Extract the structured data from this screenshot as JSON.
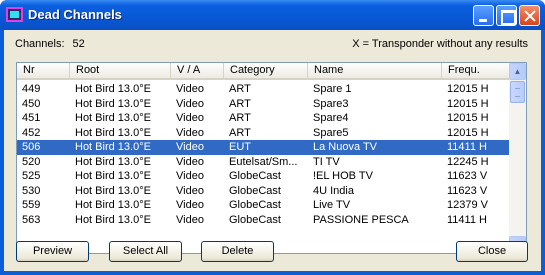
{
  "window": {
    "title": "Dead Channels",
    "icon": "app-icon"
  },
  "info": {
    "channels_label": "Channels:",
    "channels_count": "52",
    "legend": "X = Transponder without any results"
  },
  "table": {
    "columns": [
      "Nr",
      "Root",
      "V / A",
      "Category",
      "Name",
      "Frequ."
    ],
    "rows": [
      [
        "449",
        "Hot Bird 13.0°E",
        "Video",
        "ART",
        "Spare 1",
        "12015 H"
      ],
      [
        "450",
        "Hot Bird 13.0°E",
        "Video",
        "ART",
        "Spare3",
        "12015 H"
      ],
      [
        "451",
        "Hot Bird 13.0°E",
        "Video",
        "ART",
        "Spare4",
        "12015 H"
      ],
      [
        "452",
        "Hot Bird 13.0°E",
        "Video",
        "ART",
        "Spare5",
        "12015 H"
      ],
      [
        "506",
        "Hot Bird 13.0°E",
        "Video",
        "EUT",
        "La Nuova TV",
        "11411 H"
      ],
      [
        "520",
        "Hot Bird 13.0°E",
        "Video",
        "Eutelsat/Sm...",
        "TI TV",
        "12245 H"
      ],
      [
        "525",
        "Hot Bird 13.0°E",
        "Video",
        "GlobeCast",
        "!EL HOB TV",
        "11623 V"
      ],
      [
        "530",
        "Hot Bird 13.0°E",
        "Video",
        "GlobeCast",
        "4U India",
        "11623 V"
      ],
      [
        "559",
        "Hot Bird 13.0°E",
        "Video",
        "GlobeCast",
        "Live TV",
        "12379 V"
      ],
      [
        "563",
        "Hot Bird 13.0°E",
        "Video",
        "GlobeCast",
        "PASSIONE PESCA",
        "11411 H"
      ]
    ],
    "selected_index": 4
  },
  "buttons": {
    "preview": "Preview",
    "select_all": "Select All",
    "delete": "Delete",
    "close": "Close"
  },
  "colors": {
    "selection": "#316ac5",
    "titlebar": "#0858d4"
  }
}
